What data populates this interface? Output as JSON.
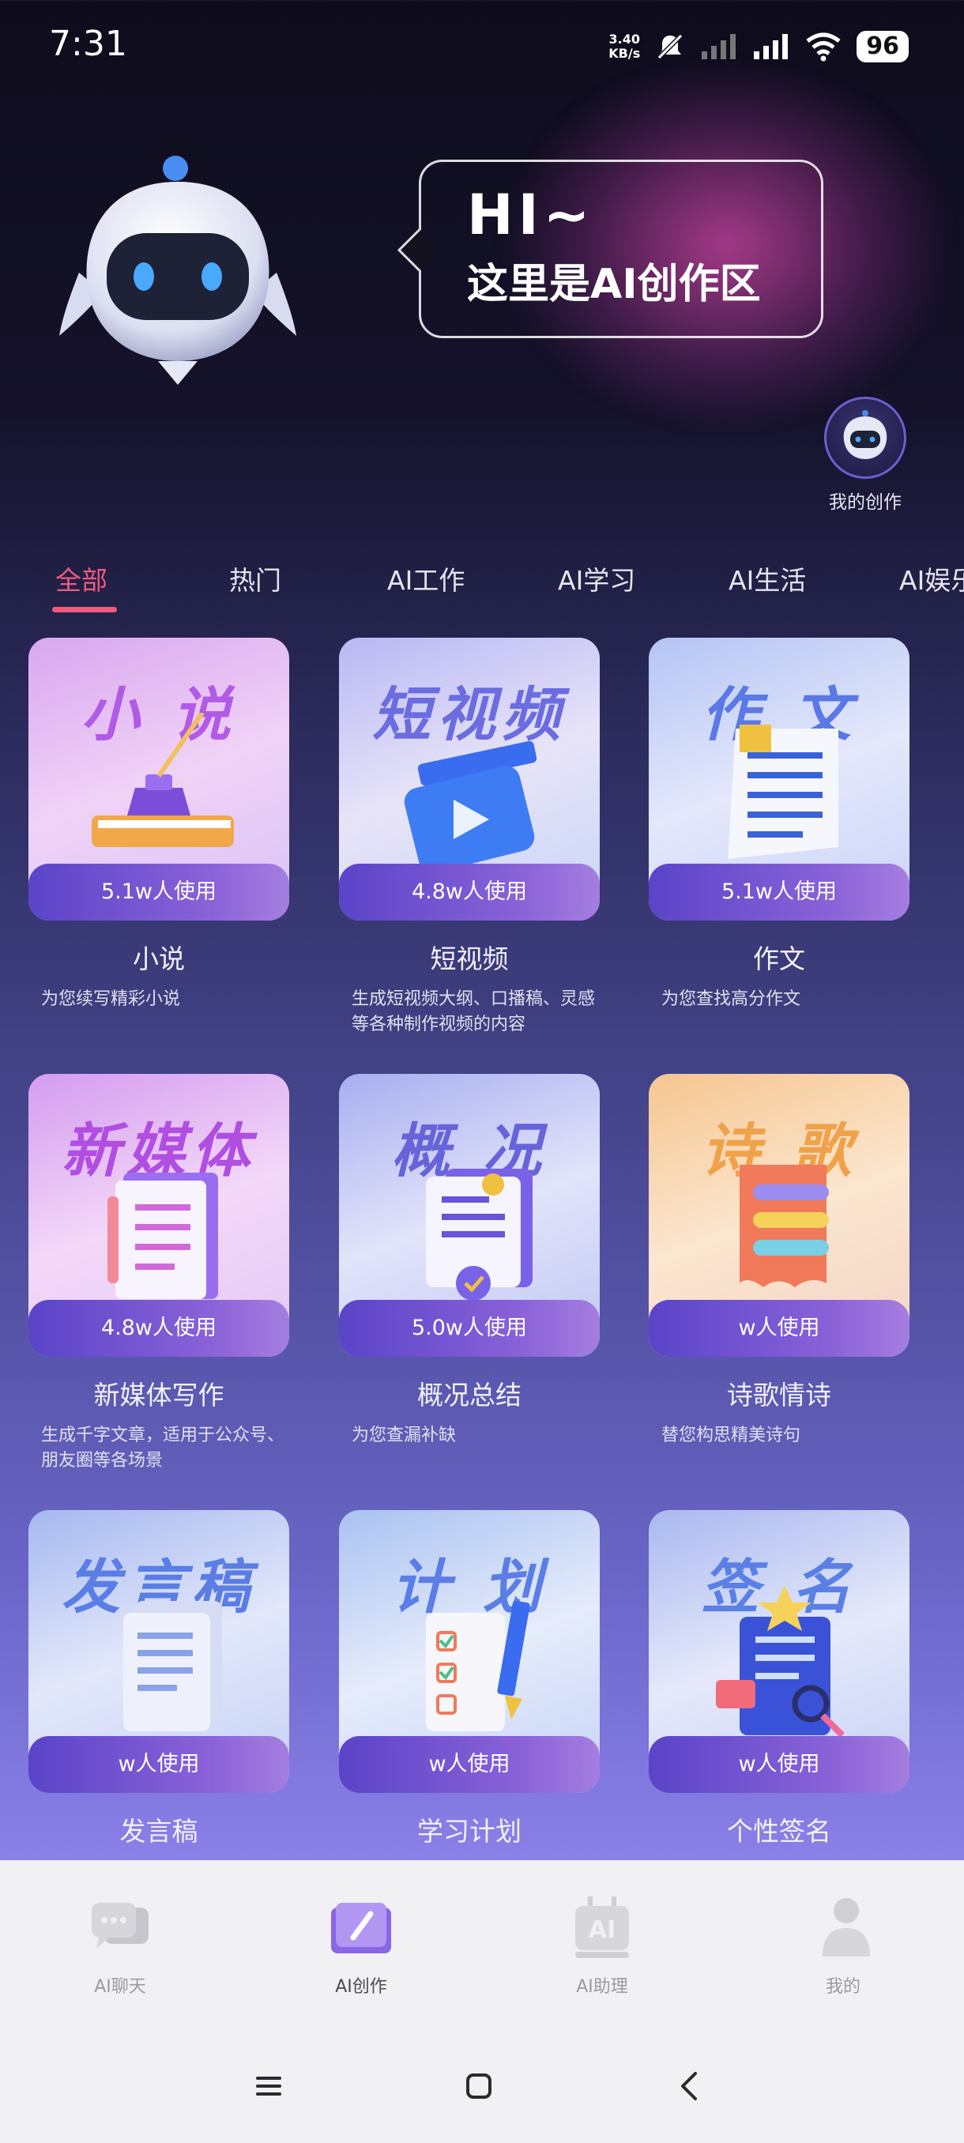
{
  "status_bar": {
    "time": "7:31",
    "speed_value": "3.40",
    "speed_unit": "KB/s",
    "battery": "96"
  },
  "hero": {
    "greeting": "HI~",
    "subtitle": "这里是AI创作区",
    "my_creation_label": "我的创作"
  },
  "tabs": [
    {
      "label": "全部",
      "active": true
    },
    {
      "label": "热门",
      "active": false
    },
    {
      "label": "AI工作",
      "active": false
    },
    {
      "label": "AI学习",
      "active": false
    },
    {
      "label": "AI生活",
      "active": false
    },
    {
      "label": "AI娱乐",
      "active": false
    }
  ],
  "cards": [
    {
      "cover_text": "小 说",
      "usage": "5.1w人使用",
      "title": "小说",
      "desc": "为您续写精彩小说",
      "cover_color": "#b05ae6"
    },
    {
      "cover_text": "短视频",
      "usage": "4.8w人使用",
      "title": "短视频",
      "desc": "生成短视频大纲、口播稿、灵感等各种制作视频的内容",
      "cover_color": "#6a6ce0"
    },
    {
      "cover_text": "作 文",
      "usage": "5.1w人使用",
      "title": "作文",
      "desc": "为您查找高分作文",
      "cover_color": "#5a78e6"
    },
    {
      "cover_text": "新媒体",
      "usage": "4.8w人使用",
      "title": "新媒体写作",
      "desc": "生成千字文章，适用于公众号、朋友圈等各场景",
      "cover_color": "#b04ee2"
    },
    {
      "cover_text": "概 况",
      "usage": "5.0w人使用",
      "title": "概况总结",
      "desc": "为您查漏补缺",
      "cover_color": "#6664d8"
    },
    {
      "cover_text": "诗 歌",
      "usage": "w人使用",
      "title": "诗歌情诗",
      "desc": "替您构思精美诗句",
      "cover_color": "#f0a24a"
    },
    {
      "cover_text": "发言稿",
      "usage": "w人使用",
      "title": "发言稿",
      "desc": "",
      "cover_color": "#5a7ee6"
    },
    {
      "cover_text": "计 划",
      "usage": "w人使用",
      "title": "学习计划",
      "desc": "",
      "cover_color": "#5a7ee6"
    },
    {
      "cover_text": "签 名",
      "usage": "w人使用",
      "title": "个性签名",
      "desc": "",
      "cover_color": "#5a80e6"
    }
  ],
  "bottom_nav": [
    {
      "label": "AI聊天",
      "icon": "chat-icon",
      "active": false
    },
    {
      "label": "AI创作",
      "icon": "book-pen-icon",
      "active": true
    },
    {
      "label": "AI助理",
      "icon": "ai-assistant-icon",
      "active": false
    },
    {
      "label": "我的",
      "icon": "person-icon",
      "active": false
    }
  ],
  "colors": {
    "accent": "#f05a7e",
    "usage_bar": "#6a50cc"
  }
}
